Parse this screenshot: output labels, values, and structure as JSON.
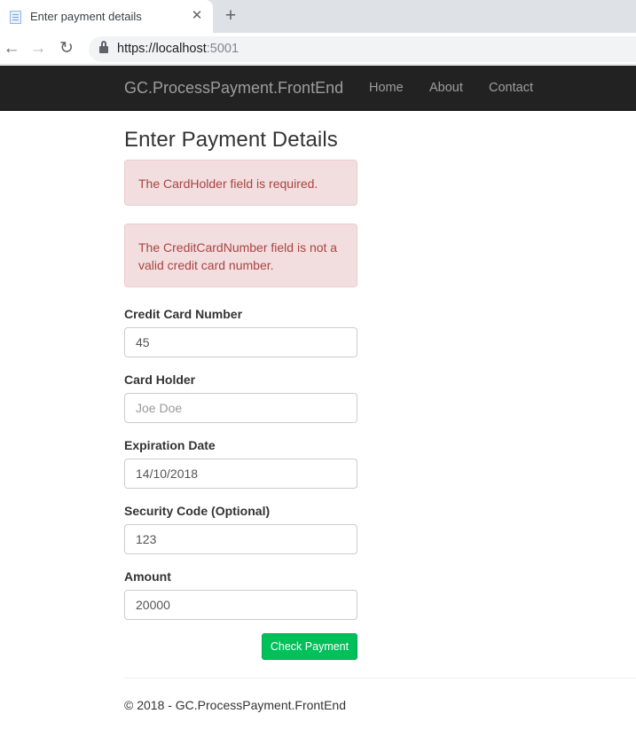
{
  "browser": {
    "tab_title": "Enter payment details",
    "tab_close": "✕",
    "new_tab": "+",
    "back": "←",
    "forward": "→",
    "reload": "↻",
    "url_main": "https://localhost",
    "url_port": ":5001"
  },
  "navbar": {
    "brand": "GC.ProcessPayment.FrontEnd",
    "links": [
      "Home",
      "About",
      "Contact"
    ]
  },
  "page": {
    "title": "Enter Payment Details",
    "errors": [
      "The CardHolder field is required.",
      "The CreditCardNumber field is not a valid credit card number."
    ],
    "fields": [
      {
        "label": "Credit Card Number",
        "value": "45",
        "placeholder": ""
      },
      {
        "label": "Card Holder",
        "value": "",
        "placeholder": "Joe Doe"
      },
      {
        "label": "Expiration Date",
        "value": "14/10/2018",
        "placeholder": ""
      },
      {
        "label": "Security Code (Optional)",
        "value": "123",
        "placeholder": ""
      },
      {
        "label": "Amount",
        "value": "20000",
        "placeholder": ""
      }
    ],
    "submit_label": "Check Payment"
  },
  "footer": {
    "text": "© 2018 - GC.ProcessPayment.FrontEnd"
  },
  "colors": {
    "navbar_bg": "#222222",
    "alert_bg": "#f2dede",
    "alert_text": "#a94442",
    "submit_bg": "#00c05a"
  }
}
